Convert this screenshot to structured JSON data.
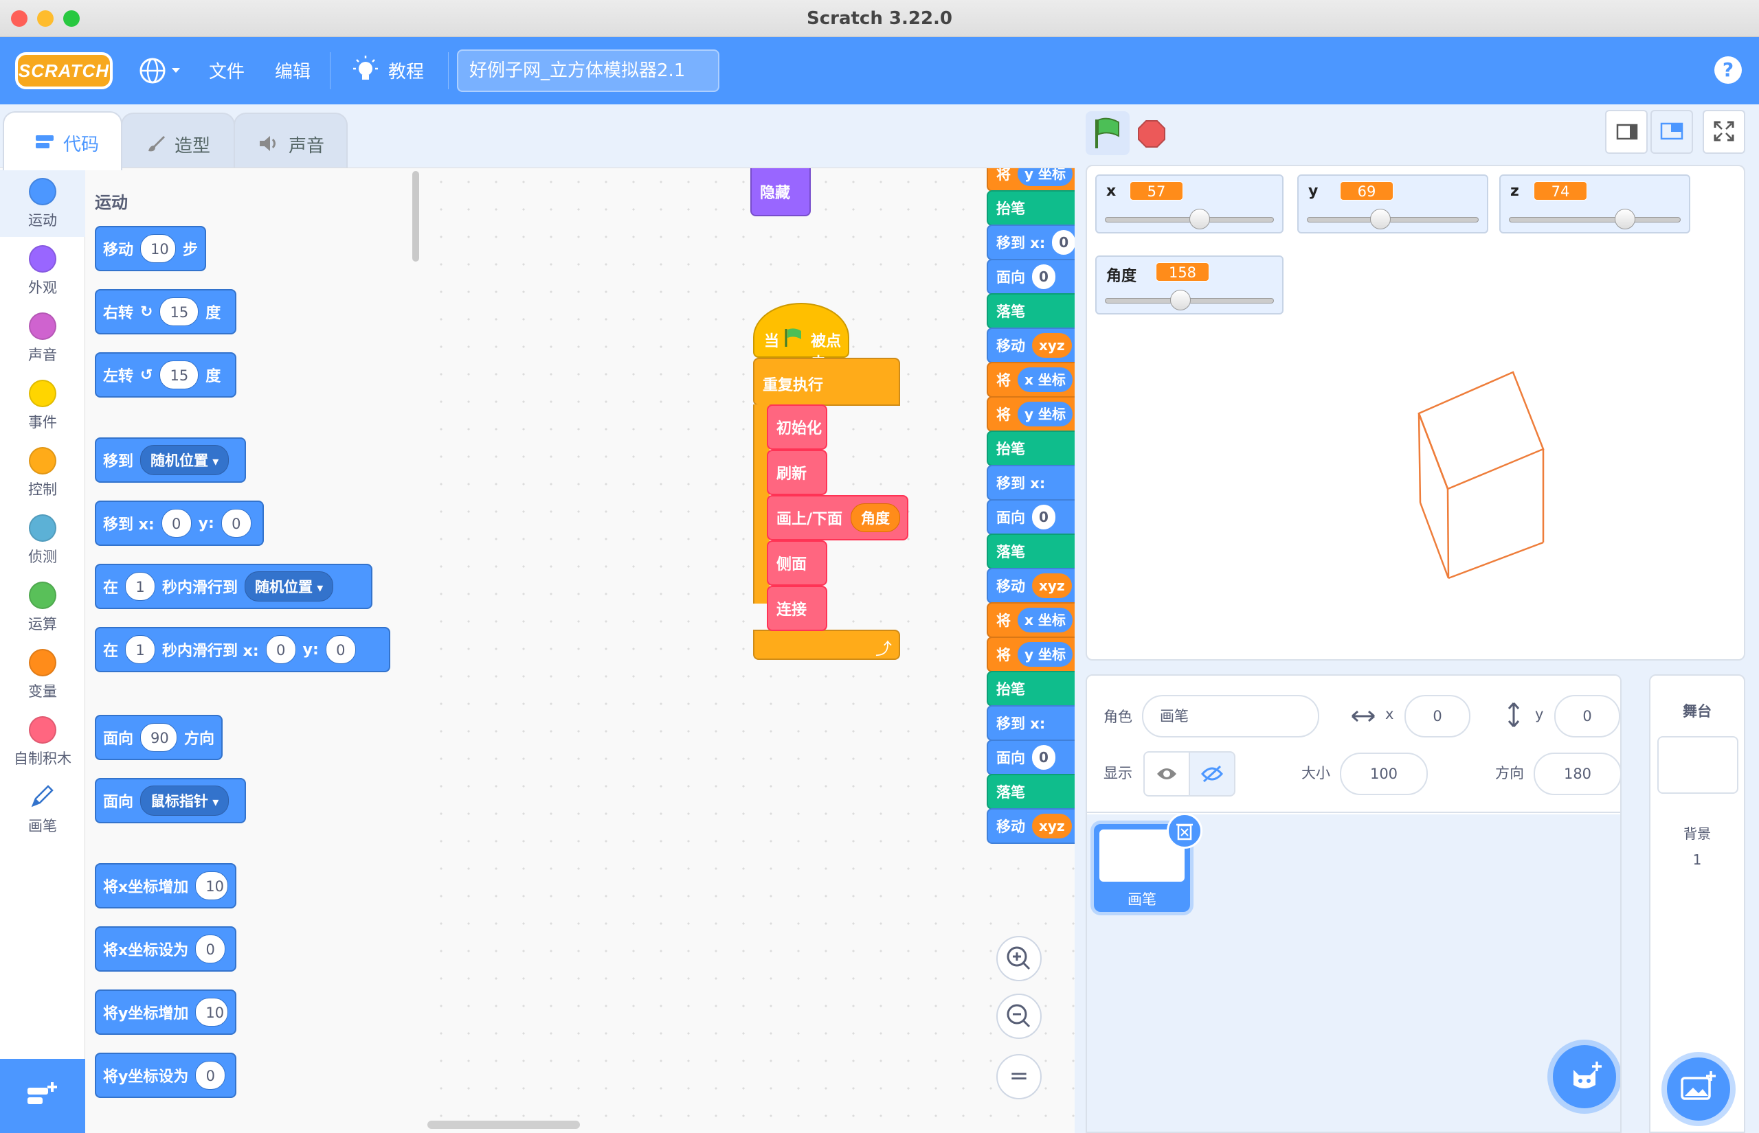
{
  "window": {
    "title": "Scratch 3.22.0"
  },
  "menubar": {
    "logo": "SCRATCH",
    "file": "文件",
    "edit": "编辑",
    "tutorials": "教程",
    "project_title": "好例子网_立方体模拟器2.1"
  },
  "tabs": {
    "code": "代码",
    "costumes": "造型",
    "sounds": "声音"
  },
  "categories": [
    {
      "label": "运动",
      "color": "#4c97ff"
    },
    {
      "label": "外观",
      "color": "#9966ff"
    },
    {
      "label": "声音",
      "color": "#cf63cf"
    },
    {
      "label": "事件",
      "color": "#ffd500"
    },
    {
      "label": "控制",
      "color": "#ffab19"
    },
    {
      "label": "侦测",
      "color": "#5cb1d6"
    },
    {
      "label": "运算",
      "color": "#59c059"
    },
    {
      "label": "变量",
      "color": "#ff8c1a"
    },
    {
      "label": "自制积木",
      "color": "#ff6680"
    },
    {
      "label": "画笔",
      "color": "#0fbd8c"
    }
  ],
  "palette": {
    "heading": "运动",
    "move": {
      "a": "移动",
      "n": "10",
      "b": "步"
    },
    "turn_right": {
      "a": "右转",
      "n": "15",
      "b": "度"
    },
    "turn_left": {
      "a": "左转",
      "n": "15",
      "b": "度"
    },
    "goto": {
      "a": "移到",
      "d": "随机位置"
    },
    "goto_xy": {
      "a": "移到 x:",
      "x": "0",
      "b": "y:",
      "y": "0"
    },
    "glide": {
      "a": "在",
      "n": "1",
      "b": "秒内滑行到",
      "d": "随机位置"
    },
    "glide_xy": {
      "a": "在",
      "n": "1",
      "b": "秒内滑行到 x:",
      "x": "0",
      "c": "y:",
      "y": "0"
    },
    "point": {
      "a": "面向",
      "n": "90",
      "b": "方向"
    },
    "point_towards": {
      "a": "面向",
      "d": "鼠标指针"
    },
    "change_x": {
      "a": "将x坐标增加",
      "n": "10"
    },
    "set_x": {
      "a": "将x坐标设为",
      "n": "0"
    },
    "change_y": {
      "a": "将y坐标增加",
      "n": "10"
    },
    "set_y": {
      "a": "将y坐标设为",
      "n": "0"
    }
  },
  "script": {
    "hide": "隐藏",
    "when": "当",
    "clicked": "被点击",
    "forever": "重复执行",
    "init": "初始化",
    "refresh": "刷新",
    "draw": "画上/下面",
    "angle": "角度",
    "side": "侧面",
    "connect": "连接"
  },
  "side_stack": [
    {
      "t": "将",
      "r": "y 坐标",
      "c": "#ff8c1a"
    },
    {
      "t": "抬笔",
      "r": "",
      "c": "#0fbd8c"
    },
    {
      "t": "移到 x:",
      "r": "0",
      "c": "#4c97ff"
    },
    {
      "t": "面向",
      "r": "0",
      "c": "#4c97ff"
    },
    {
      "t": "落笔",
      "r": "",
      "c": "#0fbd8c"
    },
    {
      "t": "移动",
      "r": "xyz",
      "c": "#4c97ff"
    },
    {
      "t": "将",
      "r": "x 坐标",
      "c": "#ff8c1a"
    },
    {
      "t": "将",
      "r": "y 坐标",
      "c": "#ff8c1a"
    },
    {
      "t": "抬笔",
      "r": "",
      "c": "#0fbd8c"
    },
    {
      "t": "移到 x:",
      "r": "",
      "c": "#4c97ff"
    },
    {
      "t": "面向",
      "r": "0",
      "c": "#4c97ff"
    },
    {
      "t": "落笔",
      "r": "",
      "c": "#0fbd8c"
    },
    {
      "t": "移动",
      "r": "xyz",
      "c": "#4c97ff"
    },
    {
      "t": "将",
      "r": "x 坐标",
      "c": "#ff8c1a"
    },
    {
      "t": "将",
      "r": "y 坐标",
      "c": "#ff8c1a"
    },
    {
      "t": "抬笔",
      "r": "",
      "c": "#0fbd8c"
    },
    {
      "t": "移到 x:",
      "r": "",
      "c": "#4c97ff"
    },
    {
      "t": "面向",
      "r": "0",
      "c": "#4c97ff"
    },
    {
      "t": "落笔",
      "r": "",
      "c": "#0fbd8c"
    },
    {
      "t": "移动",
      "r": "xyz",
      "c": "#4c97ff"
    }
  ],
  "monitors": [
    {
      "name": "x",
      "value": "57",
      "level": 0.57
    },
    {
      "name": "y",
      "value": "69",
      "level": 0.42
    },
    {
      "name": "z",
      "value": "74",
      "level": 0.7
    },
    {
      "name": "角度",
      "value": "158",
      "level": 0.44
    }
  ],
  "sprite_info": {
    "sprite_label": "角色",
    "sprite_name": "画笔",
    "x_label": "x",
    "x": "0",
    "y_label": "y",
    "y": "0",
    "show_label": "显示",
    "size_label": "大小",
    "size": "100",
    "direction_label": "方向",
    "direction": "180"
  },
  "sprite_tile": {
    "name": "画笔"
  },
  "stage_panel": {
    "title": "舞台",
    "backdrops_label": "背景",
    "backdrops_count": "1"
  },
  "zoom": {
    "in": "+",
    "out": "−",
    "reset": "="
  }
}
